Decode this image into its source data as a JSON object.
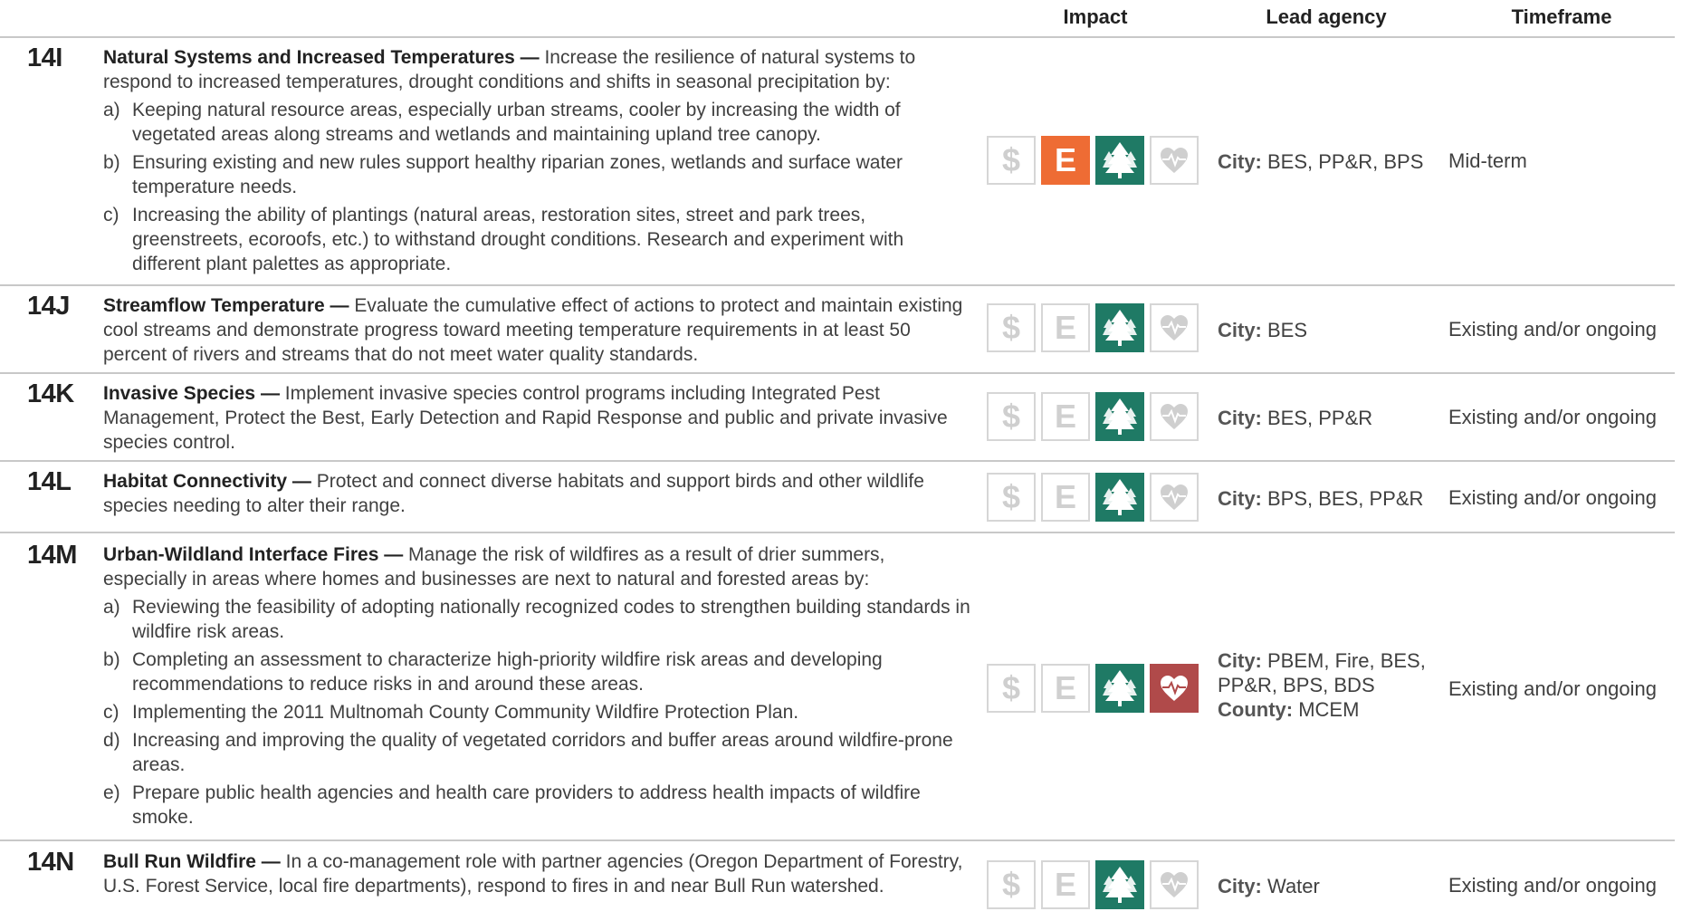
{
  "header": {
    "impact": "Impact",
    "lead_agency": "Lead agency",
    "timeframe": "Timeframe"
  },
  "colors": {
    "economic": "#ee6c34",
    "environment": "#1f7a65",
    "health": "#b04a4a",
    "inactive": "#d0d0d0"
  },
  "icons": [
    "dollar-icon",
    "economy-e-icon",
    "trees-icon",
    "heart-icon"
  ],
  "rows": [
    {
      "code": "14I",
      "title": "Natural Systems and Increased Temperatures —",
      "text": " Increase the resilience of natural systems to respond to increased temperatures, drought conditions and shifts in seasonal precipitation by:",
      "subs": [
        {
          "letter": "a)",
          "text": "Keeping natural resource areas, especially urban streams, cooler by increasing the width of vegetated areas along streams and wetlands and maintaining upland tree canopy."
        },
        {
          "letter": "b)",
          "text": "Ensuring existing and new rules support healthy riparian zones, wetlands and surface water temperature needs."
        },
        {
          "letter": "c)",
          "text": "Increasing the ability of plantings (natural areas, restoration sites, street and park trees, greenstreets, ecoroofs, etc.) to withstand drought conditions. Research and experiment with different plant palettes as appropriate."
        }
      ],
      "impact": {
        "dollar": false,
        "e": true,
        "tree": true,
        "heart": false
      },
      "agency_lines": [
        {
          "label": "City:",
          "value": " BES, PP&R, BPS"
        }
      ],
      "timeframe": "Mid-term"
    },
    {
      "code": "14J",
      "title": "Streamflow Temperature —",
      "text": " Evaluate the cumulative effect of actions to protect and maintain existing cool streams and demonstrate progress toward meeting temperature requirements in at least 50 percent of rivers and streams that do not meet water quality standards.",
      "subs": [],
      "impact": {
        "dollar": false,
        "e": false,
        "tree": true,
        "heart": false
      },
      "agency_lines": [
        {
          "label": "City:",
          "value": " BES"
        }
      ],
      "timeframe": "Existing and/or ongoing"
    },
    {
      "code": "14K",
      "title": "Invasive Species —",
      "text": " Implement invasive species control programs including Integrated Pest Management, Protect the Best, Early Detection and Rapid Response and public and private invasive species control.",
      "subs": [],
      "impact": {
        "dollar": false,
        "e": false,
        "tree": true,
        "heart": false
      },
      "agency_lines": [
        {
          "label": "City:",
          "value": " BES, PP&R"
        }
      ],
      "timeframe": "Existing and/or ongoing"
    },
    {
      "code": "14L",
      "title": "Habitat Connectivity —",
      "text": " Protect and connect diverse habitats and support birds and other wildlife species needing to alter their range.",
      "subs": [],
      "impact": {
        "dollar": false,
        "e": false,
        "tree": true,
        "heart": false
      },
      "agency_lines": [
        {
          "label": "City:",
          "value": " BPS, BES, PP&R"
        }
      ],
      "timeframe": "Existing and/or ongoing"
    },
    {
      "code": "14M",
      "title": "Urban-Wildland Interface Fires —",
      "text": " Manage the risk of wildfires as a result of drier summers, especially in areas where homes and businesses are next to natural and forested areas by:",
      "subs": [
        {
          "letter": "a)",
          "text": "Reviewing the feasibility of adopting nationally recognized codes to strengthen building standards in wildfire risk areas."
        },
        {
          "letter": "b)",
          "text": "Completing an assessment to characterize high-priority wildfire risk areas and developing recommendations to reduce risks in and around these areas."
        },
        {
          "letter": "c)",
          "text": "Implementing the 2011 Multnomah County Community Wildfire Protection Plan."
        },
        {
          "letter": "d)",
          "text": "Increasing and improving the quality of vegetated corridors and buffer areas around wildfire-prone areas."
        },
        {
          "letter": "e)",
          "text": "Prepare public health agencies and health care providers to address health impacts of wildfire smoke."
        }
      ],
      "impact": {
        "dollar": false,
        "e": false,
        "tree": true,
        "heart": true
      },
      "agency_lines": [
        {
          "label": "City:",
          "value": " PBEM, Fire, BES, PP&R, BPS, BDS"
        },
        {
          "label": "County:",
          "value": " MCEM"
        }
      ],
      "timeframe": "Existing and/or ongoing"
    },
    {
      "code": "14N",
      "title": "Bull Run Wildfire —",
      "text": " In a co-management role with partner agencies (Oregon Department of Forestry, U.S. Forest Service, local fire departments), respond to fires in and near Bull Run watershed.",
      "subs": [],
      "impact": {
        "dollar": false,
        "e": false,
        "tree": true,
        "heart": false
      },
      "agency_lines": [
        {
          "label": "City:",
          "value": " Water"
        }
      ],
      "timeframe": "Existing and/or ongoing"
    }
  ]
}
